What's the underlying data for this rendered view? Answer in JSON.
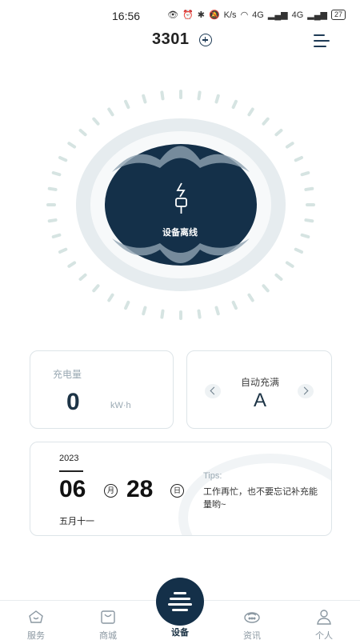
{
  "status_bar": {
    "time": "16:56",
    "network_speed": "K/s",
    "signal1": "4G",
    "signal2": "4G",
    "battery": "27"
  },
  "header": {
    "device_id": "3301",
    "add_icon": "plus-circle-icon",
    "menu_icon": "menu-icon"
  },
  "device": {
    "status_label": "设备离线",
    "plug_icon": "charger-plug-icon",
    "accent_color": "#143049"
  },
  "charge_card": {
    "label": "充电量",
    "value": "0",
    "unit": "kW·h"
  },
  "auto_card": {
    "label": "自动充满",
    "value": "A",
    "prev_icon": "chevron-left-icon",
    "next_icon": "chevron-right-icon"
  },
  "date_card": {
    "year": "2023",
    "month": "06",
    "month_unit": "月",
    "day": "28",
    "day_unit": "日",
    "lunar": "五月十一",
    "tips_title": "Tips:",
    "tips_text": "工作再忙，也不要忘记补充能量哟~"
  },
  "tabbar": {
    "items": [
      {
        "label": "服务",
        "icon": "service-icon"
      },
      {
        "label": "商城",
        "icon": "shop-icon"
      },
      {
        "label": "设备",
        "icon": "device-icon"
      },
      {
        "label": "资讯",
        "icon": "news-icon"
      },
      {
        "label": "个人",
        "icon": "person-icon"
      }
    ],
    "active_index": 2
  }
}
